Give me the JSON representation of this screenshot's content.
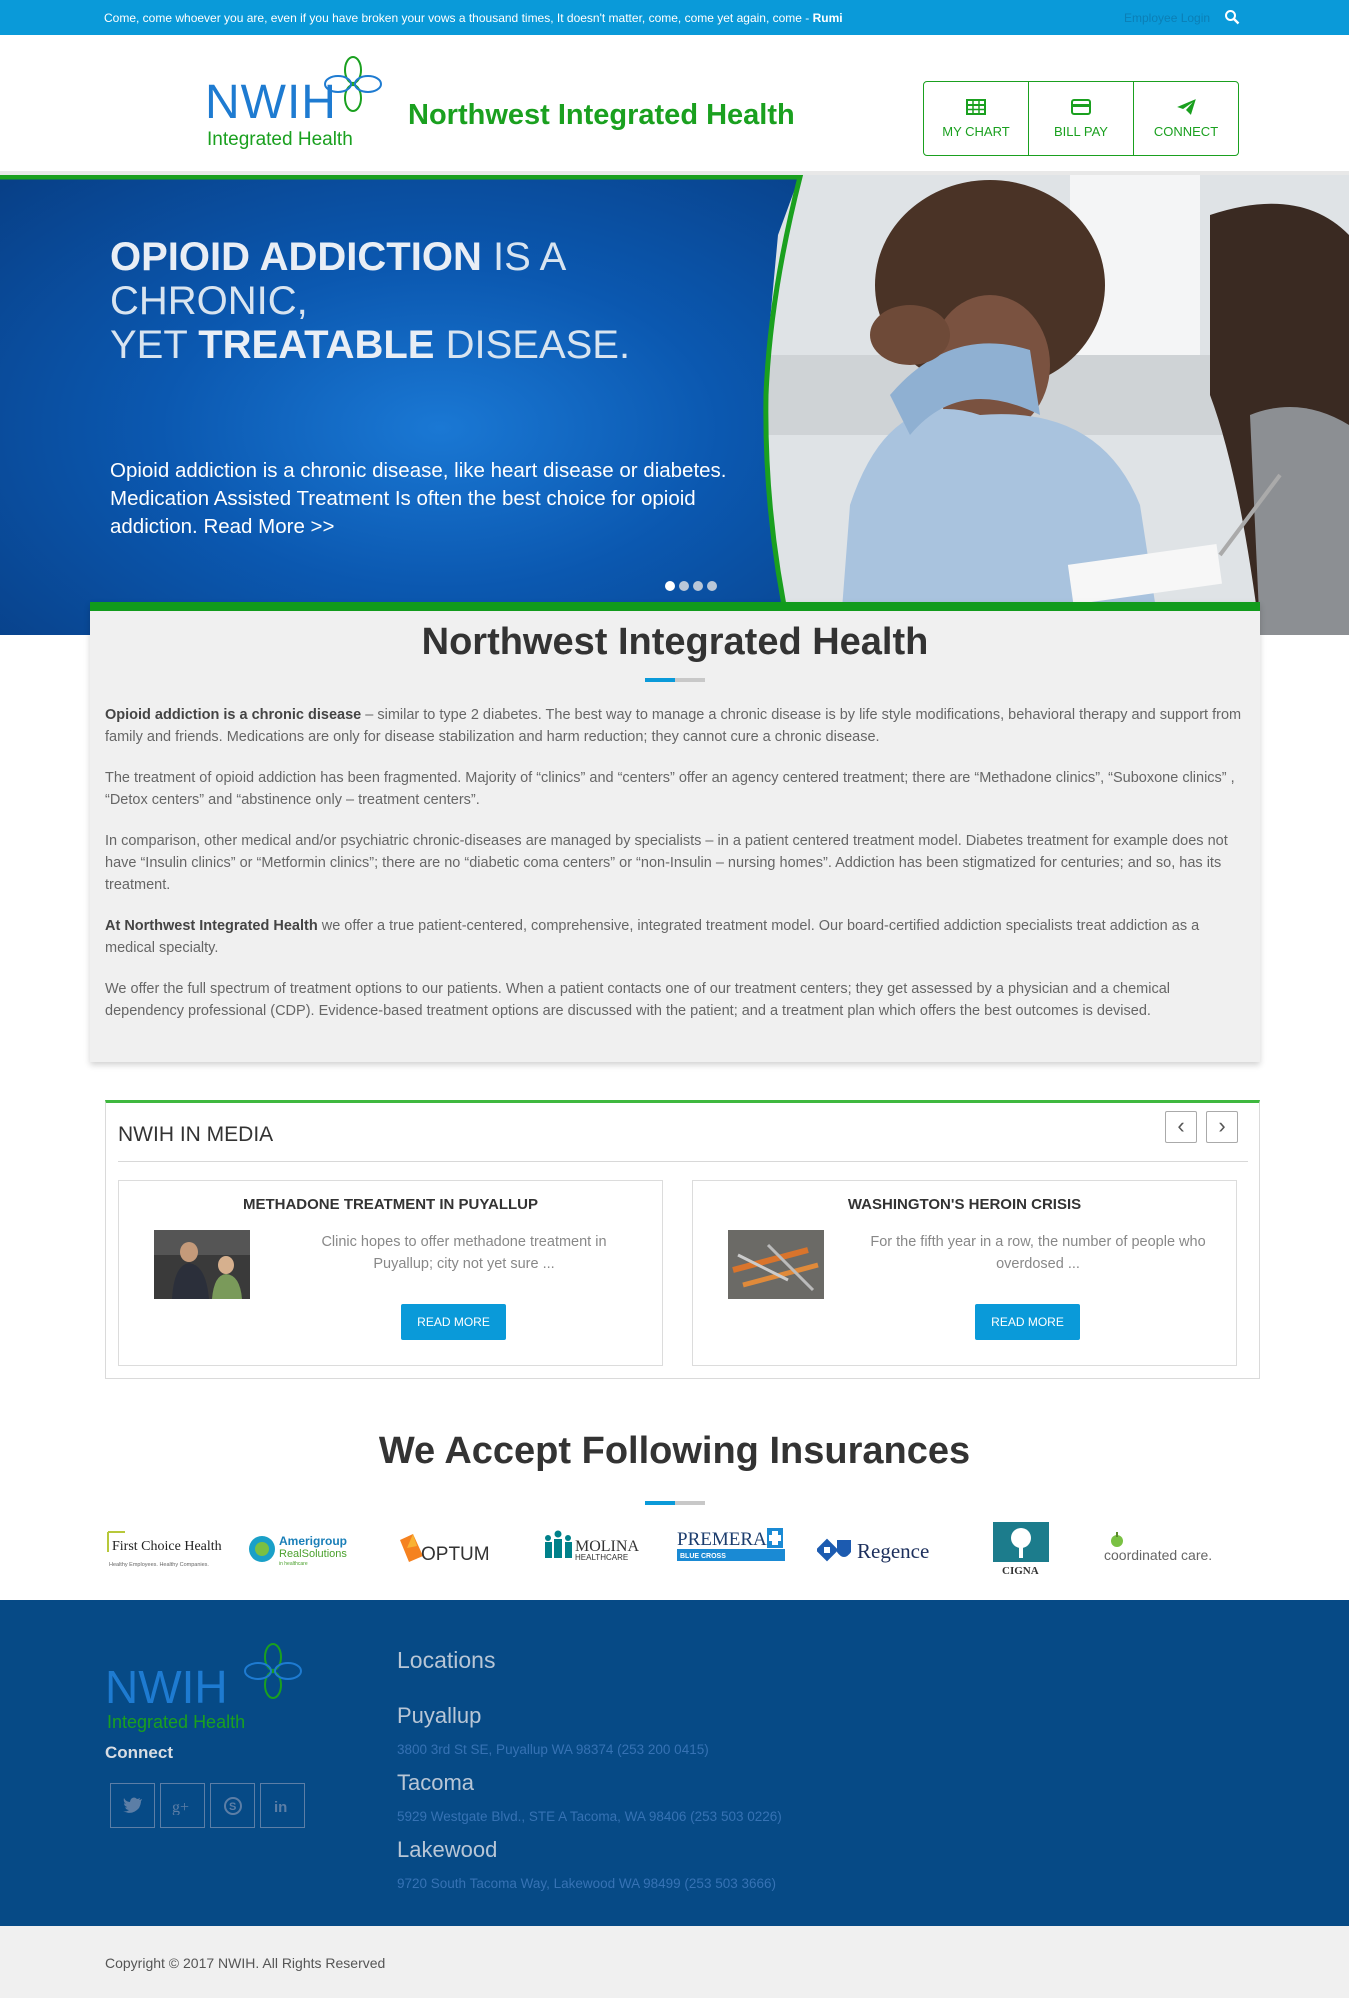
{
  "topbar": {
    "quote": "Come, come whoever you are, even if you have broken your vows a thousand times, It doesn't matter, come, come yet again, come - ",
    "quote_author": "Rumi",
    "login": "Employee Login",
    "search_icon": "search-icon"
  },
  "header": {
    "logo_main": "NWIH",
    "logo_sub": "Integrated Health",
    "brand": "Northwest Integrated Health",
    "nav": [
      {
        "label": "MY CHART",
        "icon": "table-icon"
      },
      {
        "label": "BILL PAY",
        "icon": "credit-card-icon"
      },
      {
        "label": "CONNECT",
        "icon": "paper-plane-icon"
      }
    ]
  },
  "hero": {
    "title_bold1": "OPIOID ADDICTION",
    "title_rest1": " IS A",
    "title_line2": "CHRONIC,",
    "title_yet": "YET ",
    "title_bold2": "TREATABLE",
    "title_rest2": " DISEASE.",
    "text": "Opioid addiction is a chronic disease, like heart disease or diabetes. Medication Assisted Treatment Is often the best choice for opioid addiction. Read More >>",
    "slides": 4,
    "active_slide": 1
  },
  "intro": {
    "title": "Northwest Integrated Health",
    "p1_bold": "Opioid addiction is a chronic disease",
    "p1": " – similar to type 2 diabetes. The best way to manage a chronic disease is by life style modifications, behavioral therapy and support from family and friends. Medications are only for disease stabilization and harm reduction; they cannot cure a chronic disease.",
    "p2": "The treatment of opioid addiction has been fragmented. Majority of “clinics” and “centers” offer an agency centered treatment; there are “Methadone clinics”, “Suboxone clinics” , “Detox centers” and “abstinence only – treatment centers”.",
    "p3": "In comparison, other medical and/or psychiatric chronic-diseases are managed by specialists – in a patient centered treatment model. Diabetes treatment for example does not have “Insulin clinics” or “Metformin clinics”; there are no “diabetic coma centers” or “non-Insulin – nursing homes”. Addiction has been stigmatized for centuries; and so, has its treatment.",
    "p4_bold": "At Northwest Integrated Health",
    "p4": " we offer a true patient-centered, comprehensive, integrated treatment model. Our board-certified addiction specialists treat addiction as a medical specialty.",
    "p5": "We offer the full spectrum of treatment options to our patients. When a patient contacts one of our treatment centers; they get assessed by a physician and a chemical dependency professional (CDP). Evidence-based treatment options are discussed with the patient; and a treatment plan which offers the best outcomes is devised."
  },
  "media": {
    "title": "NWIH IN MEDIA",
    "prev": "‹",
    "next": "›",
    "items": [
      {
        "title": "METHADONE TREATMENT IN PUYALLUP",
        "desc": "Clinic hopes to offer methadone treatment in Puyallup; city not yet sure ...",
        "button": "READ MORE"
      },
      {
        "title": "WASHINGTON'S HEROIN CRISIS",
        "desc": "For the fifth year in a row, the number of people who overdosed ...",
        "button": "READ MORE"
      }
    ]
  },
  "insurances": {
    "title": "We Accept Following Insurances",
    "logos": [
      {
        "name": "First Choice Health",
        "tagline": "Healthy Employees. Healthy Companies."
      },
      {
        "name": "Amerigroup",
        "sub": "RealSolutions",
        "tagline": "in healthcare"
      },
      {
        "name": "OPTUM"
      },
      {
        "name": "MOLINA",
        "sub": "HEALTHCARE"
      },
      {
        "name": "PREMERA",
        "sub": "BLUE CROSS"
      },
      {
        "name": "Regence"
      },
      {
        "name": "CIGNA"
      },
      {
        "name": "coordinated care."
      }
    ]
  },
  "footer": {
    "logo_main": "NWIH",
    "logo_sub": "Integrated Health",
    "connect": "Connect",
    "social": [
      "twitter-icon",
      "google-plus-icon",
      "skype-icon",
      "linkedin-icon"
    ],
    "locations_title": "Locations",
    "locations": [
      {
        "city": "Puyallup",
        "address": "3800 3rd St SE, Puyallup WA 98374 (253 200 0415)"
      },
      {
        "city": "Tacoma",
        "address": "5929 Westgate Blvd., STE A Tacoma, WA 98406 (253 503 0226)"
      },
      {
        "city": "Lakewood",
        "address": "9720 South Tacoma Way, Lakewood WA 98499 (253 503 3666)"
      }
    ],
    "copyright": "Copyright © 2017 NWIH. All Rights Reserved"
  }
}
